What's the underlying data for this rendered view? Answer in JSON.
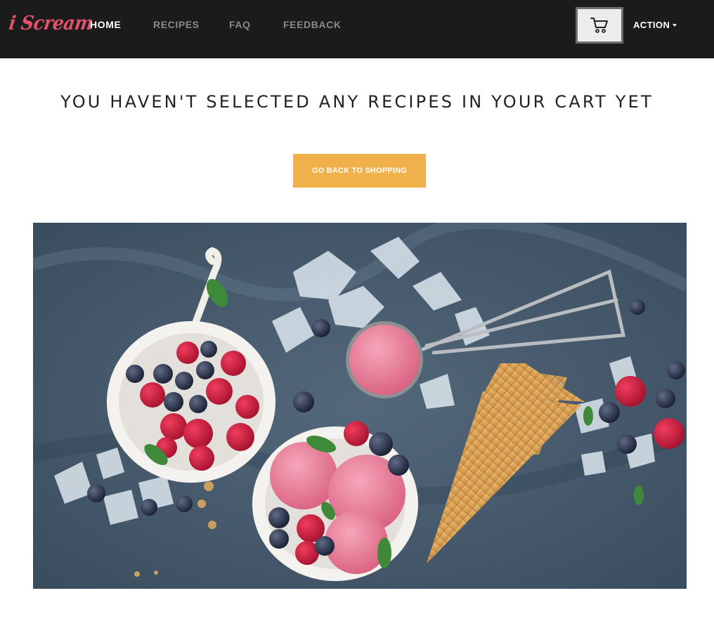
{
  "brand": {
    "logo_text": "i Scream",
    "accent_color": "#e0516b"
  },
  "nav": {
    "items": [
      {
        "label": "HOME",
        "active": true
      },
      {
        "label": "RECIPES",
        "active": false
      },
      {
        "label": "FAQ",
        "active": false
      },
      {
        "label": "FEEDBACK",
        "active": false
      }
    ],
    "cart_icon": "cart-icon",
    "action_label": "ACTION",
    "action_icon": "caret-down-icon"
  },
  "main": {
    "heading": "YOU HAVEN'T SELECTED ANY RECIPES IN YOUR CART YET",
    "back_button_label": "GO BACK TO SHOPPING",
    "button_color": "#f0b04a"
  },
  "hero_image": {
    "subject": "ice-cream-with-berries"
  }
}
